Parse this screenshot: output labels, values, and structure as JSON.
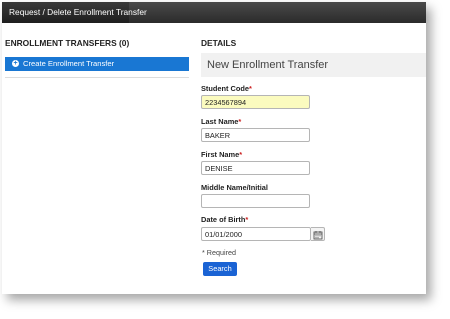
{
  "topbar": {
    "tab_label": "Request / Delete Enrollment Transfer"
  },
  "left": {
    "header": "ENROLLMENT TRANSFERS (0)",
    "items": [
      {
        "label": "Create Enrollment Transfer",
        "icon": "plus-circle-icon"
      }
    ]
  },
  "details": {
    "header": "DETAILS",
    "title": "New Enrollment Transfer",
    "fields": {
      "student_code": {
        "label": "Student Code",
        "required": "*",
        "value": "2234567894"
      },
      "last_name": {
        "label": "Last Name",
        "required": "*",
        "value": "BAKER"
      },
      "first_name": {
        "label": "First Name",
        "required": "*",
        "value": "DENISE"
      },
      "middle_name": {
        "label": "Middle Name/Initial",
        "value": ""
      },
      "date_of_birth": {
        "label": "Date of Birth",
        "required": "*",
        "value": "01/01/2000",
        "icon": "calendar-icon"
      }
    },
    "required_note": "* Required",
    "search_label": "Search"
  },
  "colors": {
    "accent": "#1977d3",
    "button": "#1a63d4",
    "highlight": "#fbfbbf",
    "required": "#cc2222"
  }
}
